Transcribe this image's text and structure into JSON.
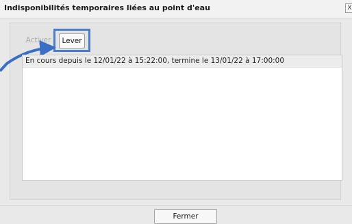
{
  "dialog": {
    "title": "Indisponibilités temporaires liées au point d'eau",
    "close_glyph": "X"
  },
  "toolbar": {
    "activer_label": "Activer",
    "lever_label": "Lever"
  },
  "list": {
    "rows": [
      {
        "text": "En cours depuis le 12/01/22 à 15:22:00, termine le 13/01/22 à 17:00:00"
      }
    ]
  },
  "footer": {
    "fermer_label": "Fermer"
  },
  "annotation": {
    "highlight_color": "#4a7cc9",
    "arrow_icon": "pointer-arrow"
  }
}
